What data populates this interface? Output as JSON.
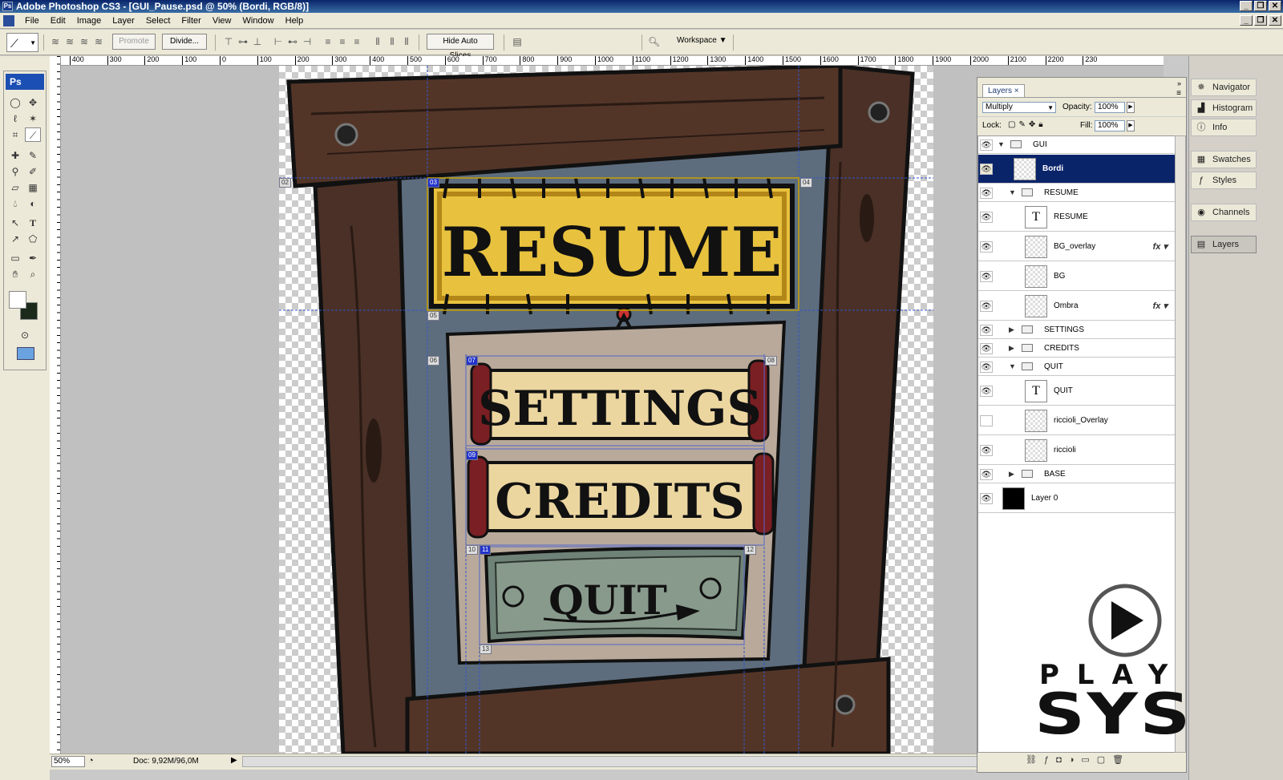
{
  "window": {
    "title": "Adobe Photoshop CS3 - [GUI_Pause.psd @ 50% (Bordi, RGB/8)]"
  },
  "menu": [
    "File",
    "Edit",
    "Image",
    "Layer",
    "Select",
    "Filter",
    "View",
    "Window",
    "Help"
  ],
  "options": {
    "promote": "Promote",
    "divide": "Divide...",
    "hide_auto_slices": "Hide Auto Slices",
    "workspace": "Workspace ▼"
  },
  "ruler_labels": [
    "500",
    "400",
    "300",
    "200",
    "100",
    "0",
    "100",
    "200",
    "300",
    "400",
    "500",
    "600",
    "700",
    "800",
    "900",
    "1000",
    "1100",
    "1200",
    "1300",
    "1400",
    "1500",
    "1600",
    "1700",
    "1800",
    "1900",
    "2000",
    "2100",
    "2200",
    "230"
  ],
  "status": {
    "zoom": "50%",
    "doc": "Doc: 9,92M/96,0M"
  },
  "artwork": {
    "resume": "RESUME",
    "settings": "SETTINGS",
    "credits": "CREDITS",
    "quit": "QUIT"
  },
  "slices": [
    "02",
    "03",
    "04",
    "05",
    "06",
    "07",
    "08",
    "09",
    "10",
    "11",
    "12",
    "13"
  ],
  "layers_panel": {
    "tab": "Layers",
    "blend_mode": "Multiply",
    "opacity_label": "Opacity:",
    "opacity": "100%",
    "lock_label": "Lock:",
    "fill_label": "Fill:",
    "fill": "100%",
    "layers": [
      {
        "name": "GUI",
        "type": "group",
        "open": true,
        "visible": true,
        "indent": 0
      },
      {
        "name": "Bordi",
        "type": "layer",
        "visible": true,
        "indent": 1,
        "selected": true
      },
      {
        "name": "RESUME",
        "type": "group",
        "open": true,
        "visible": true,
        "indent": 1
      },
      {
        "name": "RESUME",
        "type": "text",
        "visible": true,
        "indent": 2
      },
      {
        "name": "BG_overlay",
        "type": "layer",
        "visible": true,
        "indent": 2,
        "fx": true
      },
      {
        "name": "BG",
        "type": "layer",
        "visible": true,
        "indent": 2
      },
      {
        "name": "Ombra",
        "type": "layer",
        "visible": true,
        "indent": 2,
        "fx": true
      },
      {
        "name": "SETTINGS",
        "type": "group",
        "open": false,
        "visible": true,
        "indent": 1
      },
      {
        "name": "CREDITS",
        "type": "group",
        "open": false,
        "visible": true,
        "indent": 1
      },
      {
        "name": "QUIT",
        "type": "group",
        "open": true,
        "visible": true,
        "indent": 1
      },
      {
        "name": "QUIT",
        "type": "text",
        "visible": true,
        "indent": 2
      },
      {
        "name": "riccioli_Overlay",
        "type": "layer",
        "visible": false,
        "indent": 2
      },
      {
        "name": "riccioli",
        "type": "layer",
        "visible": true,
        "indent": 2
      },
      {
        "name": "BASE",
        "type": "group",
        "open": false,
        "visible": true,
        "indent": 1
      },
      {
        "name": "Layer 0",
        "type": "black",
        "visible": true,
        "indent": 0
      }
    ]
  },
  "dock": [
    "Navigator",
    "Histogram",
    "Info",
    "Swatches",
    "Styles",
    "Channels",
    "Layers"
  ],
  "watermark": {
    "line1": "PLAY",
    "line2": "SYS"
  },
  "colors": {
    "selection": "#0a246a",
    "wood": "#4a3026",
    "sign_yellow": "#e8c23e",
    "quit_grey": "#6f8277"
  }
}
